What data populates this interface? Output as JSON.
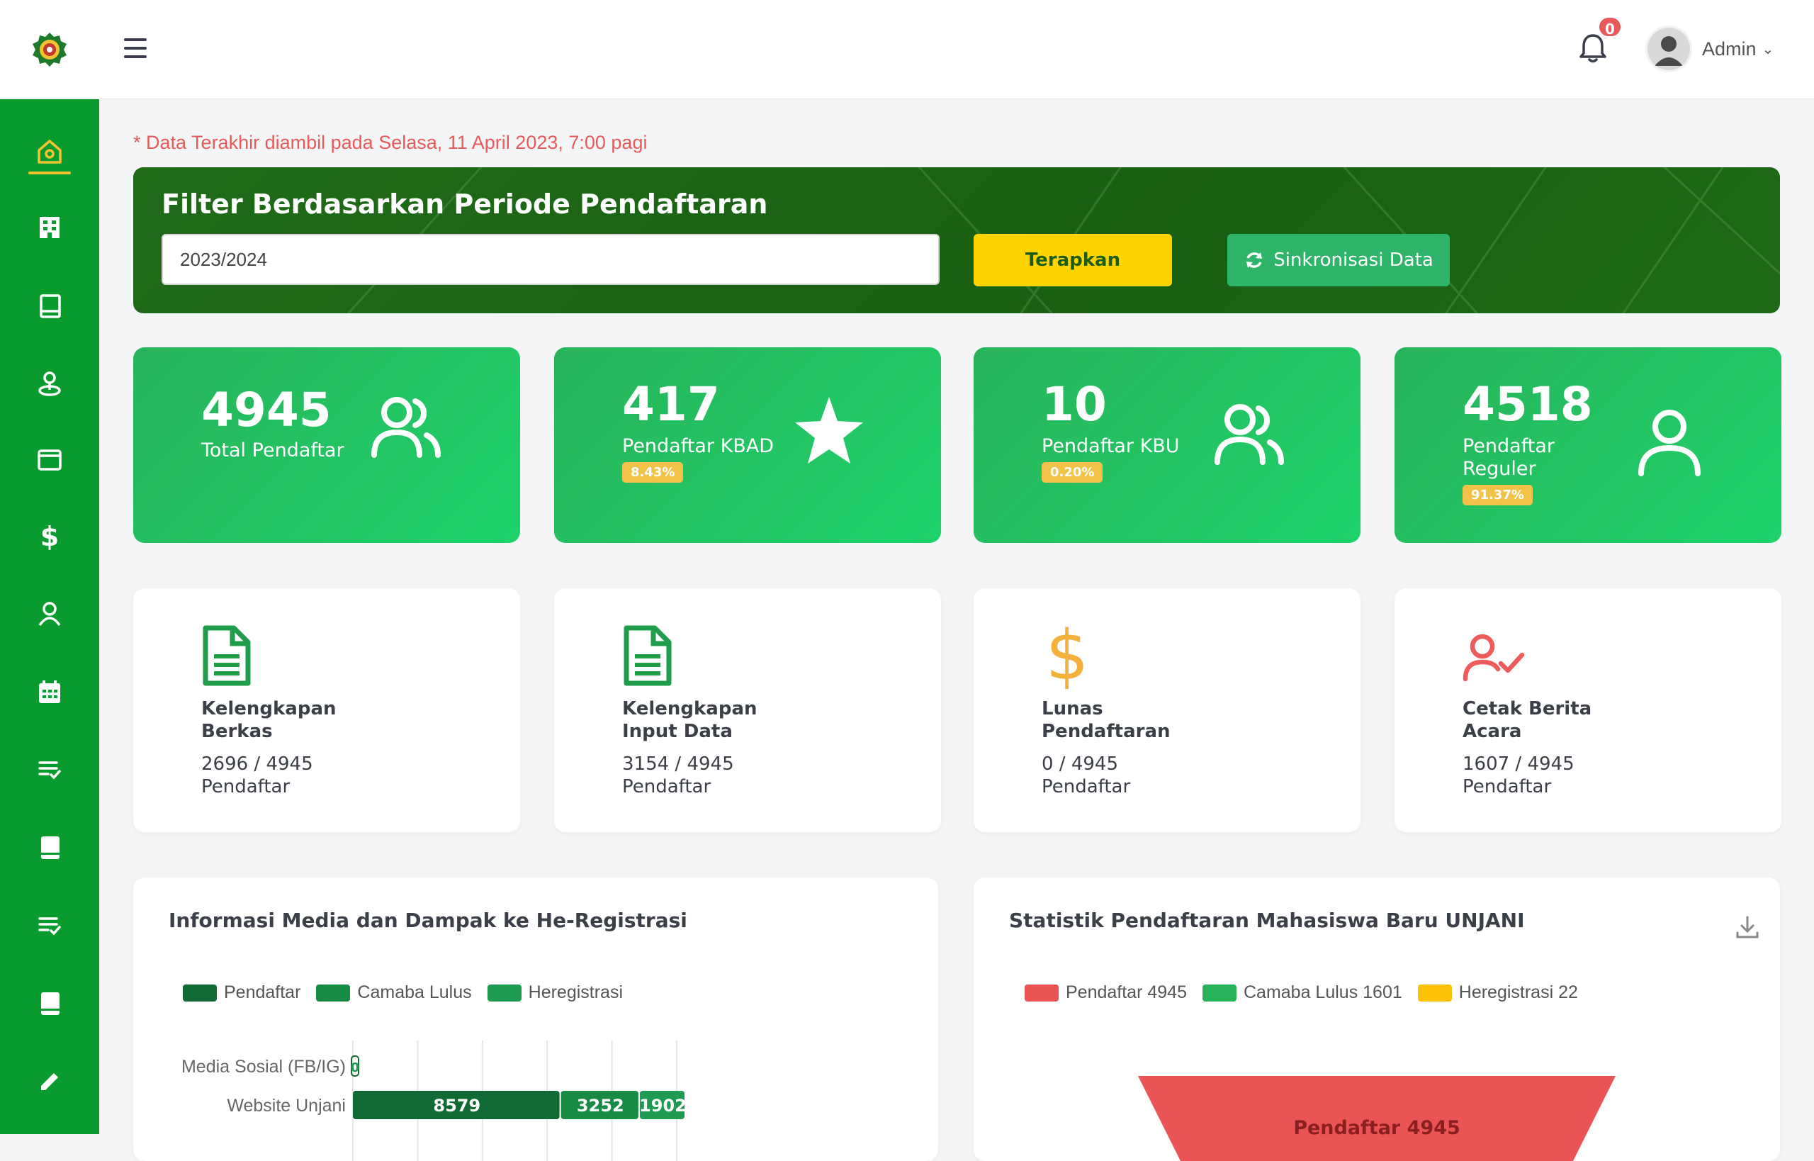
{
  "header": {
    "notification_count": "0",
    "user_name": "Admin"
  },
  "sidebar": {
    "items": [
      {
        "icon": "home-icon",
        "active": true
      },
      {
        "icon": "building-icon"
      },
      {
        "icon": "book-icon"
      },
      {
        "icon": "map-pin-icon"
      },
      {
        "icon": "wallet-icon"
      },
      {
        "icon": "dollar-icon"
      },
      {
        "icon": "user-icon"
      },
      {
        "icon": "calendar-icon"
      },
      {
        "icon": "list-check-icon"
      },
      {
        "icon": "book-closed-icon"
      },
      {
        "icon": "list-check-icon"
      },
      {
        "icon": "book-closed-icon"
      },
      {
        "icon": "pencil-icon"
      }
    ]
  },
  "notice": "* Data Terakhir diambil pada Selasa, 11 April 2023, 7:00 pagi",
  "filter": {
    "title": "Filter Berdasarkan Periode Pendaftaran",
    "value": "2023/2024",
    "apply_label": "Terapkan",
    "sync_label": "Sinkronisasi Data"
  },
  "stats": [
    {
      "number": "4945",
      "label": "Total Pendaftar",
      "icon": "users-icon"
    },
    {
      "number": "417",
      "label": "Pendaftar KBAD",
      "percent": "8.43%",
      "icon": "star-icon"
    },
    {
      "number": "10",
      "label": "Pendaftar KBU",
      "percent": "0.20%",
      "icon": "users-icon"
    },
    {
      "number": "4518",
      "label_line1": "Pendaftar",
      "label_line2": "Reguler",
      "percent": "91.37%",
      "icon": "user-icon"
    }
  ],
  "info": [
    {
      "title_line1": "Kelengkapan",
      "title_line2": "Berkas",
      "value": "2696 / 4945",
      "unit": "Pendaftar",
      "icon": "document-icon",
      "color": "#1f9d4a"
    },
    {
      "title_line1": "Kelengkapan",
      "title_line2": "Input Data",
      "value": "3154 / 4945",
      "unit": "Pendaftar",
      "icon": "document-icon",
      "color": "#1f9d4a"
    },
    {
      "title_line1": "Lunas",
      "title_line2": "Pendaftaran",
      "value": "0 / 4945",
      "unit": "Pendaftar",
      "icon": "dollar-icon",
      "color": "#f3b13b"
    },
    {
      "title_line1": "Cetak Berita",
      "title_line2": "Acara",
      "value": "1607 / 4945",
      "unit": "Pendaftar",
      "icon": "user-check-icon",
      "color": "#ee5b5b"
    }
  ],
  "panels": {
    "media": {
      "title": "Informasi Media dan Dampak ke He-Registrasi",
      "legend": [
        {
          "label": "Pendaftar",
          "color": "#0f6a33"
        },
        {
          "label": "Camaba Lulus",
          "color": "#178a43"
        },
        {
          "label": "Heregistrasi",
          "color": "#1f9a52"
        }
      ]
    },
    "stat": {
      "title": "Statistik Pendaftaran Mahasiswa Baru UNJANI",
      "legend": [
        {
          "label": "Pendaftar 4945",
          "color": "#ea5455"
        },
        {
          "label": "Camaba Lulus 1601",
          "color": "#28b35a"
        },
        {
          "label": "Heregistrasi 22",
          "color": "#ffc107"
        }
      ],
      "funnel_label": "Pendaftar 4945"
    }
  },
  "chart_data": [
    {
      "type": "bar",
      "orientation": "horizontal",
      "stacked": true,
      "categories": [
        "Media Sosial (FB/IG)",
        "Website Unjani"
      ],
      "series": [
        {
          "name": "Pendaftar",
          "values": [
            0,
            8579
          ]
        },
        {
          "name": "Camaba Lulus",
          "values": [
            0,
            3252
          ]
        },
        {
          "name": "Heregistrasi",
          "values": [
            0,
            1902
          ]
        }
      ],
      "data_labels": [
        "0",
        "8579",
        "3252",
        "1902"
      ],
      "grid": true,
      "legend": "top-left"
    },
    {
      "type": "funnel",
      "categories": [
        "Pendaftar",
        "Camaba Lulus",
        "Heregistrasi"
      ],
      "values": [
        4945,
        1601,
        22
      ],
      "legend": "top-left"
    }
  ]
}
